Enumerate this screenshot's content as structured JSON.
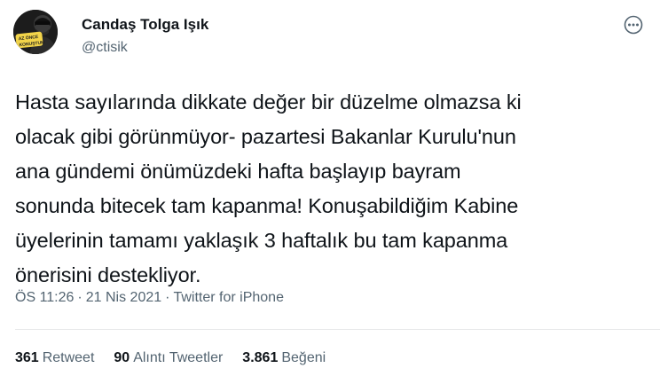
{
  "user": {
    "display_name": "Candaş Tolga Işık",
    "handle": "@ctisik",
    "avatar_text_line1": "AZ ÖNCE",
    "avatar_text_line2": "KONUŞTUM"
  },
  "more_icon": "more-dots-icon",
  "tweet": {
    "text": "Hasta sayılarında dikkate değer bir düzelme olmazsa ki\nolacak gibi görünmüyor- pazartesi Bakanlar Kurulu'nun\nana gündemi önümüzdeki hafta başlayıp bayram\nsonunda bitecek tam kapanma! Konuşabildiğim Kabine\nüyelerinin tamamı yaklaşık 3 haftalık bu tam kapanma\nönerisini destekliyor."
  },
  "meta": {
    "time": "ÖS 11:26",
    "date": "21 Nis 2021",
    "source": "Twitter for iPhone",
    "separator": "·"
  },
  "stats": {
    "retweets_count": "361",
    "retweets_label": "Retweet",
    "quotes_count": "90",
    "quotes_label": "Alıntı Tweetler",
    "likes_count": "3.861",
    "likes_label": "Beğeni"
  },
  "colors": {
    "text_primary": "#0f1419",
    "text_secondary": "#536471",
    "divider": "#e7e9ea"
  }
}
